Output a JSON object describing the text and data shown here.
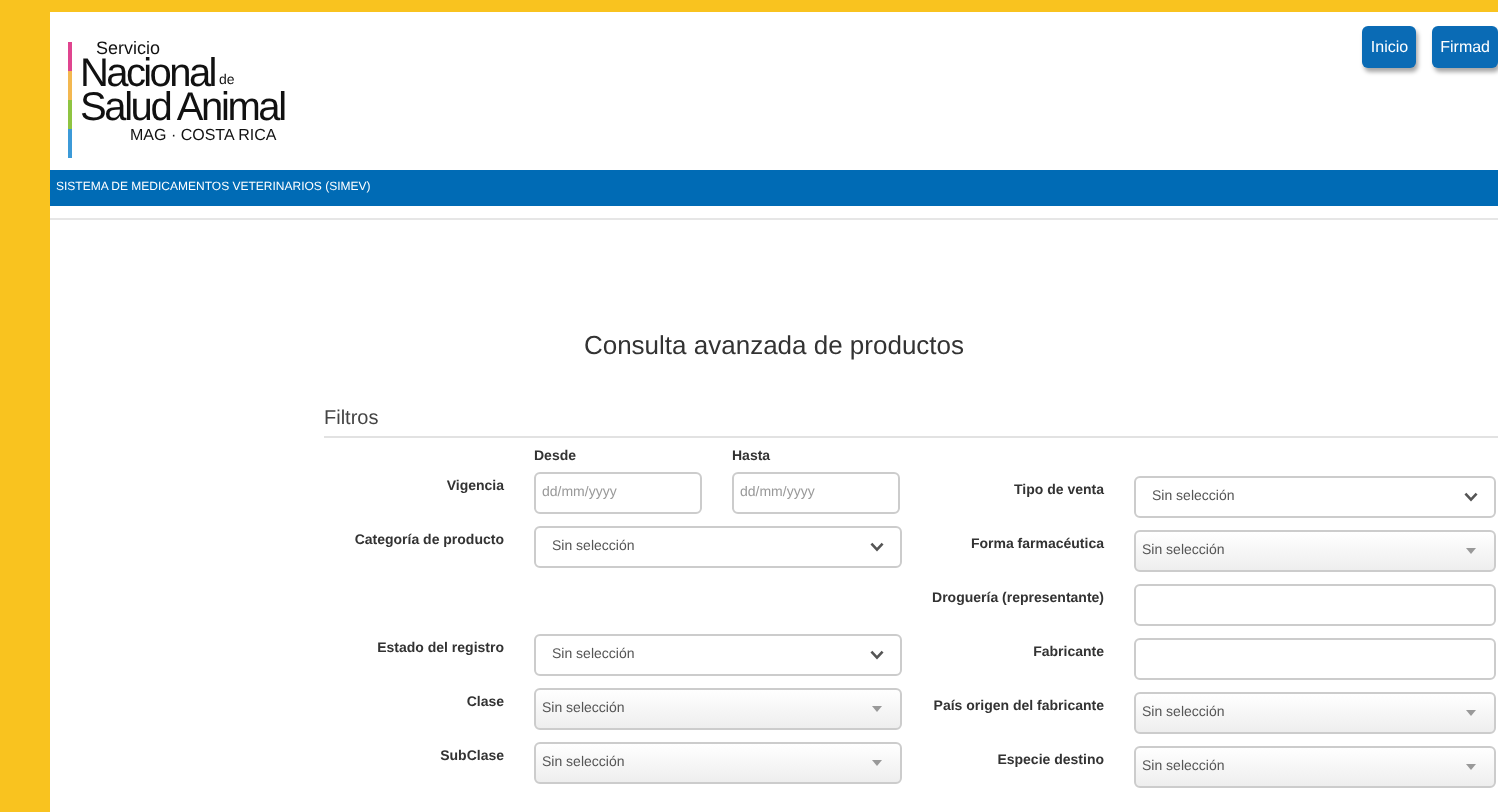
{
  "logo": {
    "line1": "Servicio",
    "line2": "Nacional",
    "line2_suffix": "de",
    "line3": "Salud Animal",
    "line4": "MAG · COSTA RICA"
  },
  "nav_buttons": [
    "Inicio",
    "Firmad"
  ],
  "system_bar": "SISTEMA DE MEDICAMENTOS VETERINARIOS (SIMEV)",
  "page_title": "Consulta avanzada de productos",
  "section_title": "Filtros",
  "left_fields": [
    {
      "kind": "date-range",
      "label": "Vigencia",
      "from_label": "Desde",
      "from_placeholder": "dd/mm/yyyy",
      "to_label": "Hasta",
      "to_placeholder": "dd/mm/yyyy"
    },
    {
      "kind": "select",
      "label": "Categoría de producto",
      "value": "Sin selección"
    },
    {
      "kind": "spacer"
    },
    {
      "kind": "select",
      "label": "Estado del registro",
      "value": "Sin selección"
    },
    {
      "kind": "combo",
      "label": "Clase",
      "value": "Sin selección"
    },
    {
      "kind": "combo",
      "label": "SubClase",
      "value": "Sin selección"
    }
  ],
  "right_fields": [
    {
      "kind": "select",
      "label": "Tipo de venta",
      "value": "Sin selección"
    },
    {
      "kind": "combo",
      "label": "Forma farmacéutica",
      "value": "Sin selección"
    },
    {
      "kind": "text",
      "label": "Droguería (representante)"
    },
    {
      "kind": "text",
      "label": "Fabricante"
    },
    {
      "kind": "combo",
      "label": "País origen del fabricante",
      "value": "Sin selección"
    },
    {
      "kind": "combo",
      "label": "Especie destino",
      "value": "Sin selección"
    }
  ]
}
